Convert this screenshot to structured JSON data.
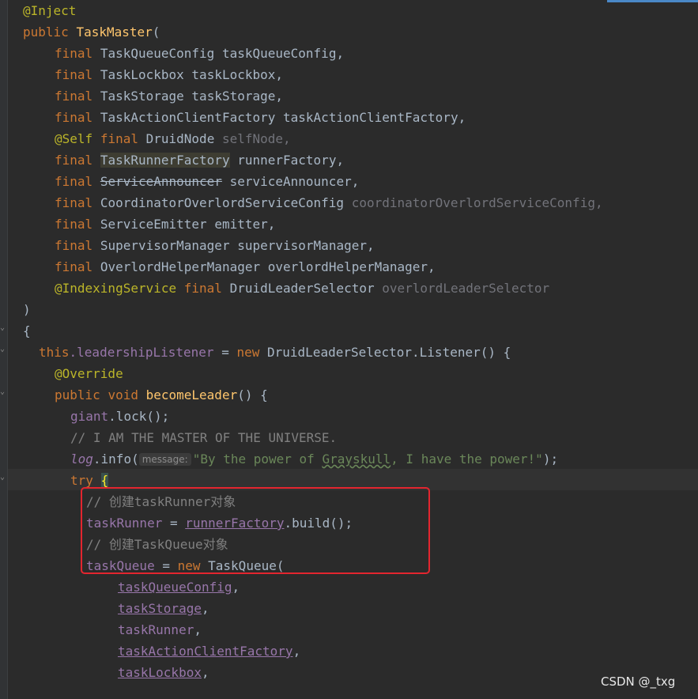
{
  "editor": {
    "lines": {
      "l1": "@Inject",
      "l2_kw": "public",
      "l2_name": "TaskMaster",
      "l2_rest": "(",
      "l3_kw": "final",
      "l3_type": "TaskQueueConfig",
      "l3_param": "taskQueueConfig,",
      "l4_kw": "final",
      "l4_type": "TaskLockbox",
      "l4_param": "taskLockbox,",
      "l5_kw": "final",
      "l5_type": "TaskStorage",
      "l5_param": "taskStorage,",
      "l6_kw": "final",
      "l6_type": "TaskActionClientFactory",
      "l6_param": "taskActionClientFactory,",
      "l7_ann": "@Self",
      "l7_kw": "final",
      "l7_type": "DruidNode",
      "l7_param": "selfNode,",
      "l8_kw": "final",
      "l8_type": "TaskRunnerFactory",
      "l8_param": "runnerFactory,",
      "l9_kw": "final",
      "l9_type": "ServiceAnnouncer",
      "l9_param": "serviceAnnouncer,",
      "l10_kw": "final",
      "l10_type": "CoordinatorOverlordServiceConfig",
      "l10_param": "coordinatorOverlordServiceConfig,",
      "l11_kw": "final",
      "l11_type": "ServiceEmitter",
      "l11_param": "emitter,",
      "l12_kw": "final",
      "l12_type": "SupervisorManager",
      "l12_param": "supervisorManager,",
      "l13_kw": "final",
      "l13_type": "OverlordHelperManager",
      "l13_param": "overlordHelperManager,",
      "l14_ann": "@IndexingService",
      "l14_kw": "final",
      "l14_type": "DruidLeaderSelector",
      "l14_param": "overlordLeaderSelector",
      "l15": ")",
      "l16": "{",
      "l17_this": "this",
      "l17_field": ".leadershipListener",
      "l17_eq": " = ",
      "l17_new": "new",
      "l17_rest": " DruidLeaderSelector.Listener() {",
      "l18_ann": "@Override",
      "l19_kw1": "public",
      "l19_kw2": "void",
      "l19_fn": "becomeLeader",
      "l19_rest": "() {",
      "l20_field": "giant",
      "l20_rest": ".lock();",
      "l21_cmt": "// I AM THE MASTER OF THE UNIVERSE.",
      "l22_log": "log",
      "l22_call": ".info(",
      "l22_hint": "message:",
      "l22_str1": "\"By the power of ",
      "l22_str_wavy": "Grayskull",
      "l22_str2": ", I have the power!\"",
      "l22_end": ");",
      "l23_kw": "try",
      "l23_brace": "{",
      "l24_cmt": "// 创建taskRunner对象",
      "l25_field": "taskRunner",
      "l25_eq": " = ",
      "l25_field2": "runnerFactory",
      "l25_rest": ".build();",
      "l26_cmt": "// 创建TaskQueue对象",
      "l27_field": "taskQueue",
      "l27_eq": " = ",
      "l27_new": "new",
      "l27_rest": " TaskQueue(",
      "l28": "taskQueueConfig",
      "l29": "taskStorage",
      "l30": "taskRunner",
      "l31": "taskActionClientFactory",
      "l32": "taskLockbox"
    }
  },
  "watermark": "CSDN @_txg"
}
